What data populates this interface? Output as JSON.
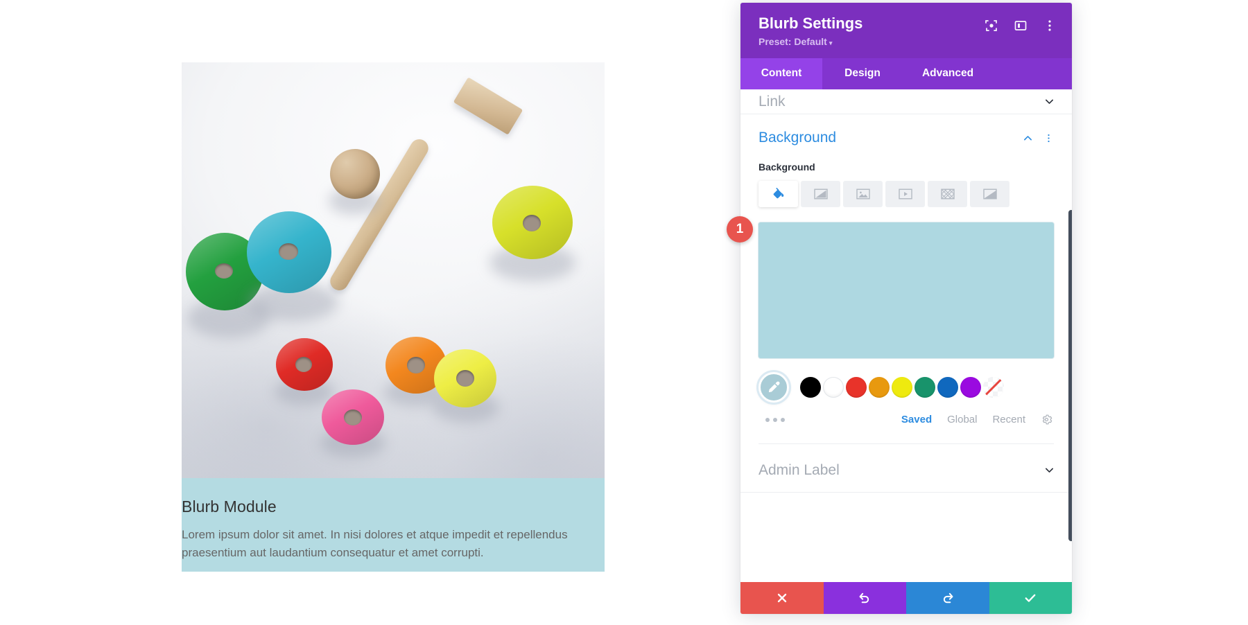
{
  "preview": {
    "module_title": "Blurb Module",
    "module_text": "Lorem ipsum dolor sit amet. In nisi dolores et atque impedit et repellendus praesentium aut laudantium consequatur et amet corrupti.",
    "module_background_color": "#b4dbe2",
    "photo_alt": "wooden toy stacking rings with hammer and ball"
  },
  "panel": {
    "title": "Blurb Settings",
    "preset_label": "Preset: Default",
    "preset_caret": "▾",
    "header_icons": [
      {
        "name": "focus-icon"
      },
      {
        "name": "layout-toggle-icon"
      },
      {
        "name": "more-options-icon"
      }
    ],
    "tabs": [
      {
        "label": "Content",
        "active": true
      },
      {
        "label": "Design",
        "active": false
      },
      {
        "label": "Advanced",
        "active": false
      }
    ],
    "collapsed_sections": [
      {
        "label": "Link"
      },
      {
        "label": "Admin Label"
      }
    ],
    "background_section": {
      "title": "Background",
      "field_label": "Background",
      "collapse_icon": "chevron-up-icon",
      "menu_icon": "more-options-icon",
      "type_tabs": [
        {
          "name": "background-color-tab",
          "active": true
        },
        {
          "name": "background-gradient-tab",
          "active": false
        },
        {
          "name": "background-image-tab",
          "active": false
        },
        {
          "name": "background-video-tab",
          "active": false
        },
        {
          "name": "background-pattern-tab",
          "active": false
        },
        {
          "name": "background-mask-tab",
          "active": false
        }
      ],
      "selected_color": "#aed8e1",
      "eyedropper_color": "#a9ccd6",
      "swatches": [
        {
          "name": "swatch-black",
          "color": "#000000"
        },
        {
          "name": "swatch-white",
          "color": "#ffffff"
        },
        {
          "name": "swatch-red",
          "color": "#e8332a"
        },
        {
          "name": "swatch-orange",
          "color": "#e8990f"
        },
        {
          "name": "swatch-yellow",
          "color": "#eeea0f"
        },
        {
          "name": "swatch-green",
          "color": "#18936b"
        },
        {
          "name": "swatch-blue",
          "color": "#1068be"
        },
        {
          "name": "swatch-purple",
          "color": "#9a0ae0"
        },
        {
          "name": "swatch-transparent",
          "color": "none"
        }
      ],
      "footer_links": [
        {
          "label": "Saved",
          "active": true
        },
        {
          "label": "Global",
          "active": false
        },
        {
          "label": "Recent",
          "active": false
        }
      ],
      "settings_icon": "gear-icon",
      "more_dots": "more-colors-icon"
    },
    "actions": [
      {
        "name": "cancel-button",
        "icon": "close-icon",
        "color": "#e8544e"
      },
      {
        "name": "undo-button",
        "icon": "undo-icon",
        "color": "#8a30dd"
      },
      {
        "name": "redo-button",
        "icon": "redo-icon",
        "color": "#2b87d6"
      },
      {
        "name": "save-button",
        "icon": "check-icon",
        "color": "#2dbd95"
      }
    ]
  },
  "annotation": {
    "step_number": "1"
  }
}
